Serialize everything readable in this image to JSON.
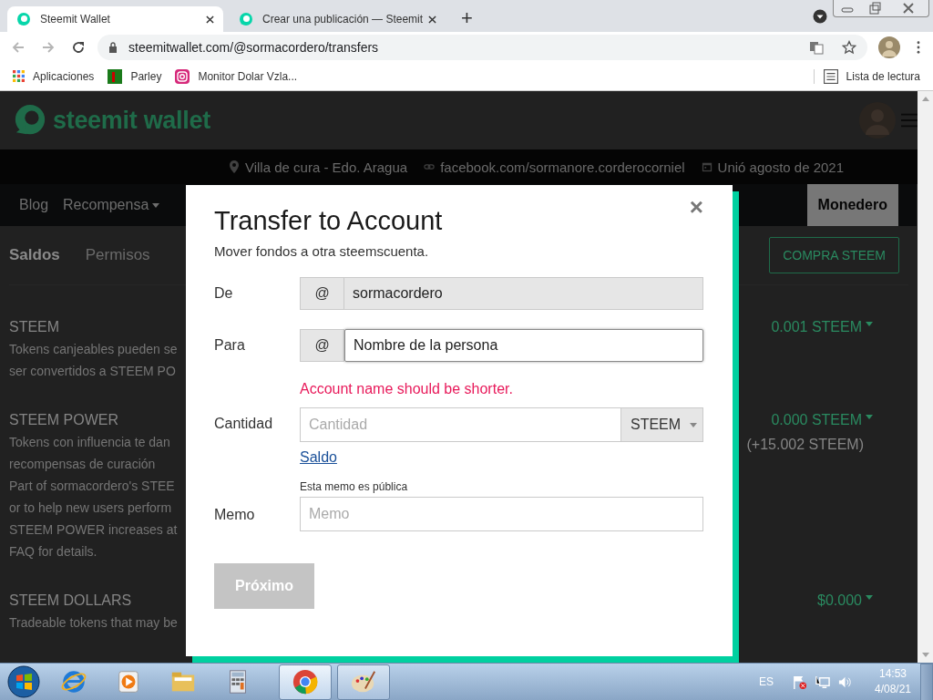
{
  "browser": {
    "tabs": [
      {
        "title": "Steemit Wallet",
        "selected": true
      },
      {
        "title": "Crear una publicación — Steemit",
        "selected": false
      }
    ],
    "new_tab": "+",
    "url": "steemitwallet.com/@sormacordero/transfers",
    "bookmarks": [
      {
        "label": "Aplicaciones",
        "kind": "apps"
      },
      {
        "label": "Parley",
        "kind": "parley"
      },
      {
        "label": "Monitor Dolar Vzla...",
        "kind": "instagram"
      }
    ],
    "reading_list": "Lista de lectura"
  },
  "page": {
    "logo": "steemit wallet",
    "profile": [
      {
        "kind": "location",
        "text": "Villa de cura - Edo. Aragua"
      },
      {
        "kind": "link",
        "text": "facebook.com/sormanore.corderocorniel"
      },
      {
        "kind": "calendar",
        "text": "Unió agosto de 2021"
      }
    ],
    "nav": [
      {
        "label": "Blog",
        "selected": false,
        "dropdown": false
      },
      {
        "label": "Recompensa",
        "selected": false,
        "dropdown": true
      },
      {
        "label": "Monedero",
        "selected": true,
        "dropdown": false
      }
    ],
    "subtabs": [
      {
        "label": "Saldos",
        "selected": true
      },
      {
        "label": "Permisos",
        "selected": false
      }
    ],
    "buy_button": "COMPRA STEEM",
    "balances": [
      {
        "name": "STEEM",
        "description": [
          "Tokens canjeables pueden se",
          "ser convertidos a STEEM PO"
        ],
        "amounts": [
          {
            "text": "0.001 STEEM",
            "dropdown": true
          }
        ]
      },
      {
        "name": "STEEM POWER",
        "description": [
          "Tokens con influencia te dan",
          "recompensas de curación",
          "Part of sormacordero's STEE",
          "or to help new users perform",
          "STEEM POWER increases at",
          "FAQ for details."
        ],
        "amounts": [
          {
            "text": "0.000 STEEM",
            "dropdown": true
          },
          {
            "text": "(+15.002 STEEM)",
            "dropdown": false
          }
        ]
      },
      {
        "name": "STEEM DOLLARS",
        "description": [
          "Tradeable tokens that may be"
        ],
        "amounts": [
          {
            "text": "$0.000",
            "dropdown": true
          }
        ]
      }
    ]
  },
  "modal": {
    "title": "Transfer to Account",
    "close": "×",
    "subtitle": "Mover fondos a otra steemscuenta.",
    "from": {
      "label": "De",
      "prefix": "@",
      "value": "sormacordero",
      "disabled": true
    },
    "to": {
      "label": "Para",
      "prefix": "@",
      "value": "Nombre de la persona",
      "disabled": false
    },
    "error": "Account name should be shorter.",
    "amount": {
      "label": "Cantidad",
      "placeholder": "Cantidad",
      "asset": "STEEM",
      "balance_link": "Saldo"
    },
    "memo": {
      "label": "Memo",
      "note": "Esta memo es pública",
      "placeholder": "Memo"
    },
    "submit": {
      "label": "Próximo",
      "disabled": true
    }
  },
  "taskbar": {
    "language": "ES",
    "time": "14:53",
    "date": "4/08/21"
  }
}
